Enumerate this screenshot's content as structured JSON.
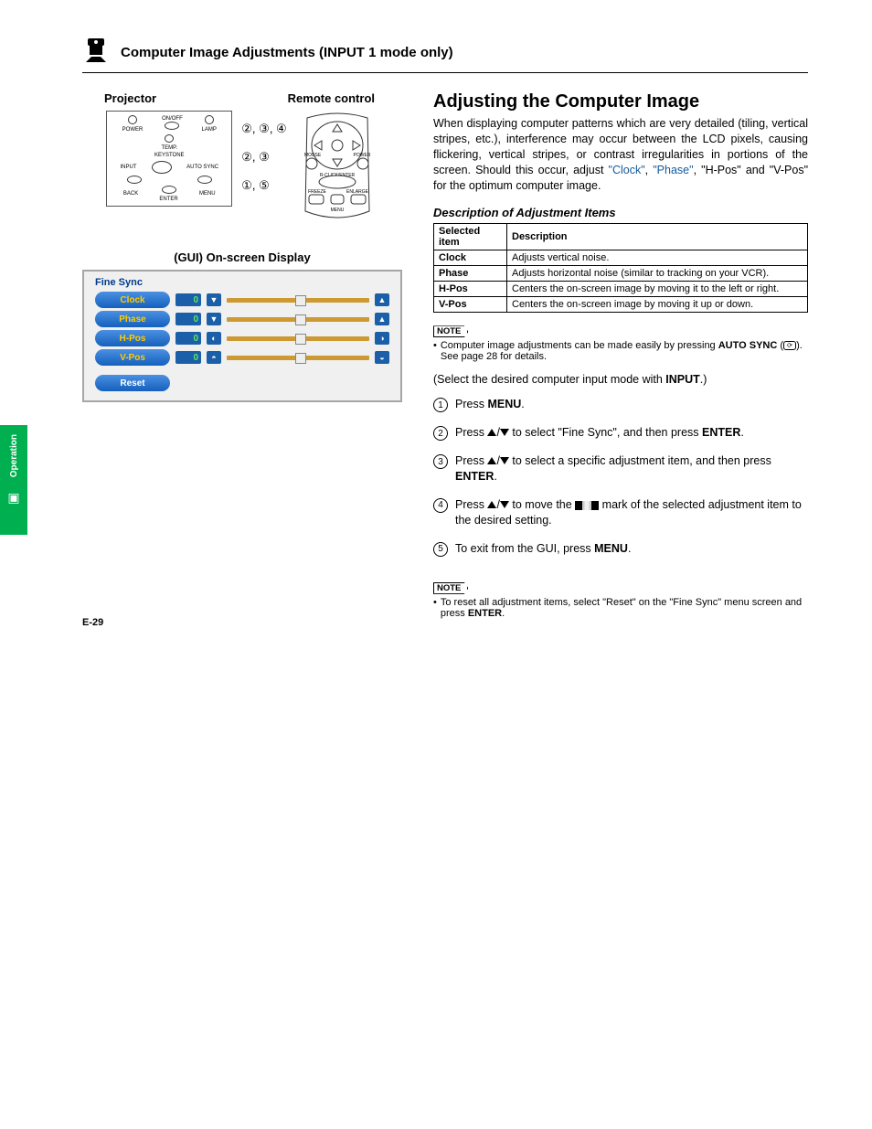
{
  "side_tab": {
    "label": "Operation"
  },
  "header": {
    "title": "Computer Image Adjustments (INPUT 1 mode only)"
  },
  "labels": {
    "projector": "Projector",
    "remote": "Remote control"
  },
  "projector_panel": {
    "power": "POWER",
    "onoff": "ON/OFF",
    "lamp": "LAMP",
    "temp": "TEMP.",
    "keystone": "KEYSTONE",
    "input": "INPUT",
    "autosync": "AUTO SYNC",
    "back": "BACK",
    "enter": "ENTER",
    "menu": "MENU"
  },
  "remote_panel": {
    "mouse": "MOUSE",
    "power": "POWER",
    "rclick": "R-CLICK/ENTER",
    "freeze": "FREEZE",
    "enlarge": "ENLARGE",
    "menu": "MENU"
  },
  "callouts": {
    "r1": "②, ③, ④",
    "r2": "②, ③",
    "r3": "①, ⑤"
  },
  "gui": {
    "title": "(GUI) On-screen Display",
    "panel_label": "Fine Sync",
    "rows": [
      {
        "label": "Clock",
        "value": "0"
      },
      {
        "label": "Phase",
        "value": "0"
      },
      {
        "label": "H-Pos",
        "value": "0"
      },
      {
        "label": "V-Pos",
        "value": "0"
      }
    ],
    "reset": "Reset"
  },
  "right": {
    "h2": "Adjusting the Computer Image",
    "intro_a": "When displaying computer patterns which are very detailed (tiling, vertical stripes, etc.), interference may occur between the LCD pixels, causing flickering, vertical stripes, or contrast irregularities in portions of the screen. Should this occur, adjust ",
    "clock": "\"Clock\"",
    "comma1": ", ",
    "phase": "\"Phase\"",
    "intro_b": ", \"H-Pos\" and \"V-Pos\" for the optimum computer image.",
    "h3": "Description of Adjustment Items",
    "table": {
      "head1": "Selected item",
      "head2": "Description",
      "rows": [
        {
          "item": "Clock",
          "desc": "Adjusts vertical noise."
        },
        {
          "item": "Phase",
          "desc": "Adjusts horizontal noise (similar to tracking on your VCR)."
        },
        {
          "item": "H-Pos",
          "desc": "Centers the on-screen image by moving it to the left or right."
        },
        {
          "item": "V-Pos",
          "desc": "Centers the on-screen image by moving it up or down."
        }
      ]
    },
    "note_label": "NOTE",
    "note1a": "Computer image adjustments can be made easily by pressing ",
    "note1b": "AUTO SYNC",
    "note1c": " (",
    "note1d": "). See page 28 for details.",
    "paren_a": "(Select the desired computer input mode with ",
    "paren_b": "INPUT",
    "paren_c": ".)",
    "steps": {
      "s1a": "Press ",
      "s1b": "MENU",
      "s1c": ".",
      "s2a": "Press ",
      "s2b": " to select \"Fine Sync\", and then press ",
      "s2c": "ENTER",
      "s2d": ".",
      "s3a": "Press ",
      "s3b": " to select a specific adjustment item, and then press ",
      "s3c": "ENTER",
      "s3d": ".",
      "s4a": "Press ",
      "s4b": " to move the ",
      "s4c": " mark of the selected adjustment item to the desired setting.",
      "s5a": "To exit from the GUI, press ",
      "s5b": "MENU",
      "s5c": "."
    },
    "note2": "To reset all adjustment items, select \"Reset\" on the \"Fine Sync\" menu screen and press ",
    "note2b": "ENTER",
    "note2c": "."
  },
  "footer": "E-29"
}
